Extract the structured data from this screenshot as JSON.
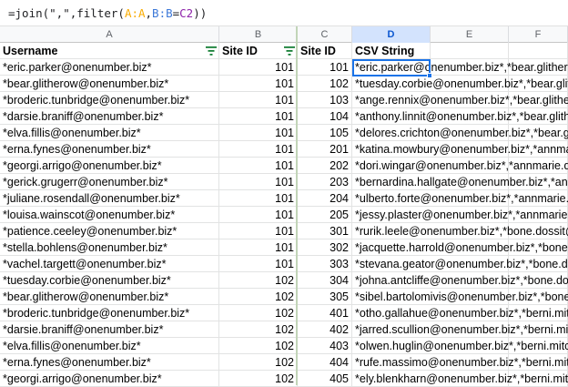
{
  "formula": {
    "prefix": "=join(\",\",filter(",
    "range_a": "A:A",
    "sep": ",",
    "range_b": "B:B",
    "eq": "=",
    "range_c": "C2",
    "suffix": "))"
  },
  "columns": [
    "A",
    "B",
    "C",
    "D",
    "E",
    "F"
  ],
  "selected_column": "D",
  "header_row": {
    "a": "Username",
    "b": "Site ID",
    "c": "Site ID",
    "d": "CSV String"
  },
  "rows": [
    {
      "a": "*eric.parker@onenumber.biz*",
      "b": "101",
      "c": "101",
      "d": "*eric.parker@onenumber.biz*,*bear.glitherow@onenumber.biz*"
    },
    {
      "a": "*bear.glitherow@onenumber.biz*",
      "b": "101",
      "c": "102",
      "d": "*tuesday.corbie@onenumber.biz*,*bear.glitherow@onenumber.biz*"
    },
    {
      "a": "*broderic.tunbridge@onenumber.biz*",
      "b": "101",
      "c": "103",
      "d": "*ange.rennix@onenumber.biz*,*bear.glitherow@onenumber.biz*"
    },
    {
      "a": "*darsie.braniff@onenumber.biz*",
      "b": "101",
      "c": "104",
      "d": "*anthony.linnit@onenumber.biz*,*bear.glitherow@onenumber.biz*"
    },
    {
      "a": "*elva.fillis@onenumber.biz*",
      "b": "101",
      "c": "105",
      "d": "*delores.crichton@onenumber.biz*,*bear.glitherow@onenumber.biz*"
    },
    {
      "a": "*erna.fynes@onenumber.biz*",
      "b": "101",
      "c": "201",
      "d": "*katina.mowbury@onenumber.biz*,*annmarie.dimeloe@onenumber.biz*"
    },
    {
      "a": "*georgi.arrigo@onenumber.biz*",
      "b": "101",
      "c": "202",
      "d": "*dori.wingar@onenumber.biz*,*annmarie.dimeloe@onenumber.biz*"
    },
    {
      "a": "*gerick.grugerr@onenumber.biz*",
      "b": "101",
      "c": "203",
      "d": "*bernardina.hallgate@onenumber.biz*,*annmarie.dimeloe@onenumber.biz*"
    },
    {
      "a": "*juliane.rosendall@onenumber.biz*",
      "b": "101",
      "c": "204",
      "d": "*ulberto.forte@onenumber.biz*,*annmarie.dimeloe@onenumber.biz*"
    },
    {
      "a": "*louisa.wainscot@onenumber.biz*",
      "b": "101",
      "c": "205",
      "d": "*jessy.plaster@onenumber.biz*,*annmarie.dimeloe@onenumber.biz*"
    },
    {
      "a": "*patience.ceeley@onenumber.biz*",
      "b": "101",
      "c": "301",
      "d": "*rurik.leele@onenumber.biz*,*bone.dossit@onenumber.biz*"
    },
    {
      "a": "*stella.bohlens@onenumber.biz*",
      "b": "101",
      "c": "302",
      "d": "*jacquette.harrold@onenumber.biz*,*bone.dossit@onenumber.biz*"
    },
    {
      "a": "*vachel.targett@onenumber.biz*",
      "b": "101",
      "c": "303",
      "d": "*stevana.geator@onenumber.biz*,*bone.dossit@onenumber.biz*"
    },
    {
      "a": "*tuesday.corbie@onenumber.biz*",
      "b": "102",
      "c": "304",
      "d": "*johna.antcliffe@onenumber.biz*,*bone.dossit@onenumber.biz*"
    },
    {
      "a": "*bear.glitherow@onenumber.biz*",
      "b": "102",
      "c": "305",
      "d": "*sibel.bartolomivis@onenumber.biz*,*bone.dossit@onenumber.biz*"
    },
    {
      "a": "*broderic.tunbridge@onenumber.biz*",
      "b": "102",
      "c": "401",
      "d": "*otho.gallahue@onenumber.biz*,*berni.mitchelyn@onenumber.biz*"
    },
    {
      "a": "*darsie.braniff@onenumber.biz*",
      "b": "102",
      "c": "402",
      "d": "*jarred.scullion@onenumber.biz*,*berni.mitchelyn@onenumber.biz*"
    },
    {
      "a": "*elva.fillis@onenumber.biz*",
      "b": "102",
      "c": "403",
      "d": "*olwen.huglin@onenumber.biz*,*berni.mitchelyn@onenumber.biz*"
    },
    {
      "a": "*erna.fynes@onenumber.biz*",
      "b": "102",
      "c": "404",
      "d": "*rufe.massimo@onenumber.biz*,*berni.mitchelyn@onenumber.biz*"
    },
    {
      "a": "*georgi.arrigo@onenumber.biz*",
      "b": "102",
      "c": "405",
      "d": "*ely.blenkharn@onenumber.biz*,*berni.mitchelyn@onenumber.biz*"
    }
  ],
  "colors": {
    "accent": "#1a73e8",
    "filter_icon": "#188038",
    "range_a": "#f9ab00",
    "range_b": "#3c78d8",
    "range_c": "#8e24aa"
  },
  "icons": {
    "filter": "filter-icon"
  }
}
